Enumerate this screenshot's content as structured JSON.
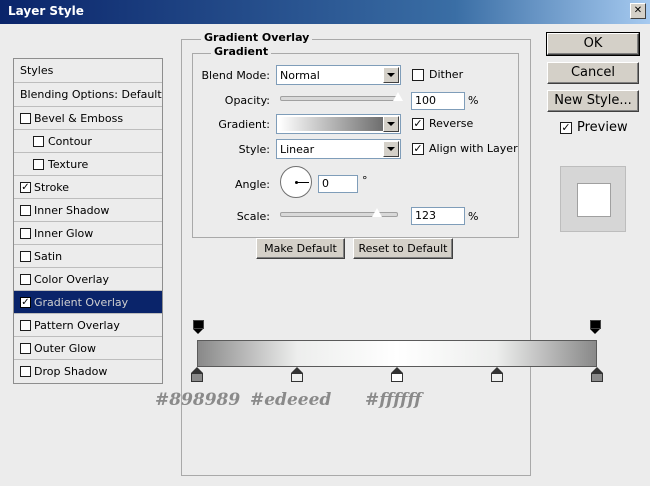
{
  "window": {
    "title": "Layer Style",
    "close_glyph": "✕"
  },
  "styles_list": {
    "header": "Styles",
    "blending": "Blending Options: Default",
    "items": [
      {
        "label": "Bevel & Emboss",
        "checked": false,
        "sub": false
      },
      {
        "label": "Contour",
        "checked": false,
        "sub": true
      },
      {
        "label": "Texture",
        "checked": false,
        "sub": true
      },
      {
        "label": "Stroke",
        "checked": true,
        "sub": false
      },
      {
        "label": "Inner Shadow",
        "checked": false,
        "sub": false
      },
      {
        "label": "Inner Glow",
        "checked": false,
        "sub": false
      },
      {
        "label": "Satin",
        "checked": false,
        "sub": false
      },
      {
        "label": "Color Overlay",
        "checked": false,
        "sub": false
      },
      {
        "label": "Gradient Overlay",
        "checked": true,
        "sub": false,
        "selected": true
      },
      {
        "label": "Pattern Overlay",
        "checked": false,
        "sub": false
      },
      {
        "label": "Outer Glow",
        "checked": false,
        "sub": false
      },
      {
        "label": "Drop Shadow",
        "checked": false,
        "sub": false
      }
    ]
  },
  "panel": {
    "outer_title": "Gradient Overlay",
    "inner_title": "Gradient",
    "blend_mode_label": "Blend Mode:",
    "blend_mode_value": "Normal",
    "dither_label": "Dither",
    "dither_checked": false,
    "opacity_label": "Opacity:",
    "opacity_value": "100",
    "opacity_unit": "%",
    "opacity_level": 1.0,
    "gradient_label": "Gradient:",
    "reverse_label": "Reverse",
    "reverse_checked": true,
    "style_label": "Style:",
    "style_value": "Linear",
    "align_label": "Align with Layer",
    "align_checked": true,
    "angle_label": "Angle:",
    "angle_value": "0",
    "angle_unit": "°",
    "scale_label": "Scale:",
    "scale_value": "123",
    "scale_unit": "%",
    "scale_level": 0.82,
    "make_default": "Make Default",
    "reset_default": "Reset to Default"
  },
  "buttons": {
    "ok": "OK",
    "cancel": "Cancel",
    "new_style": "New Style...",
    "preview_label": "Preview",
    "preview_checked": true
  },
  "gradient_editor": {
    "stops": [
      "#898989",
      "#edeeed",
      "#ffffff",
      "#edeeed",
      "#898989"
    ],
    "hex_labels": [
      "#898989",
      "#edeeed",
      "#ffffff"
    ]
  },
  "colors": {
    "selection": "#0a246a",
    "dialog_bg": "#ececec"
  }
}
